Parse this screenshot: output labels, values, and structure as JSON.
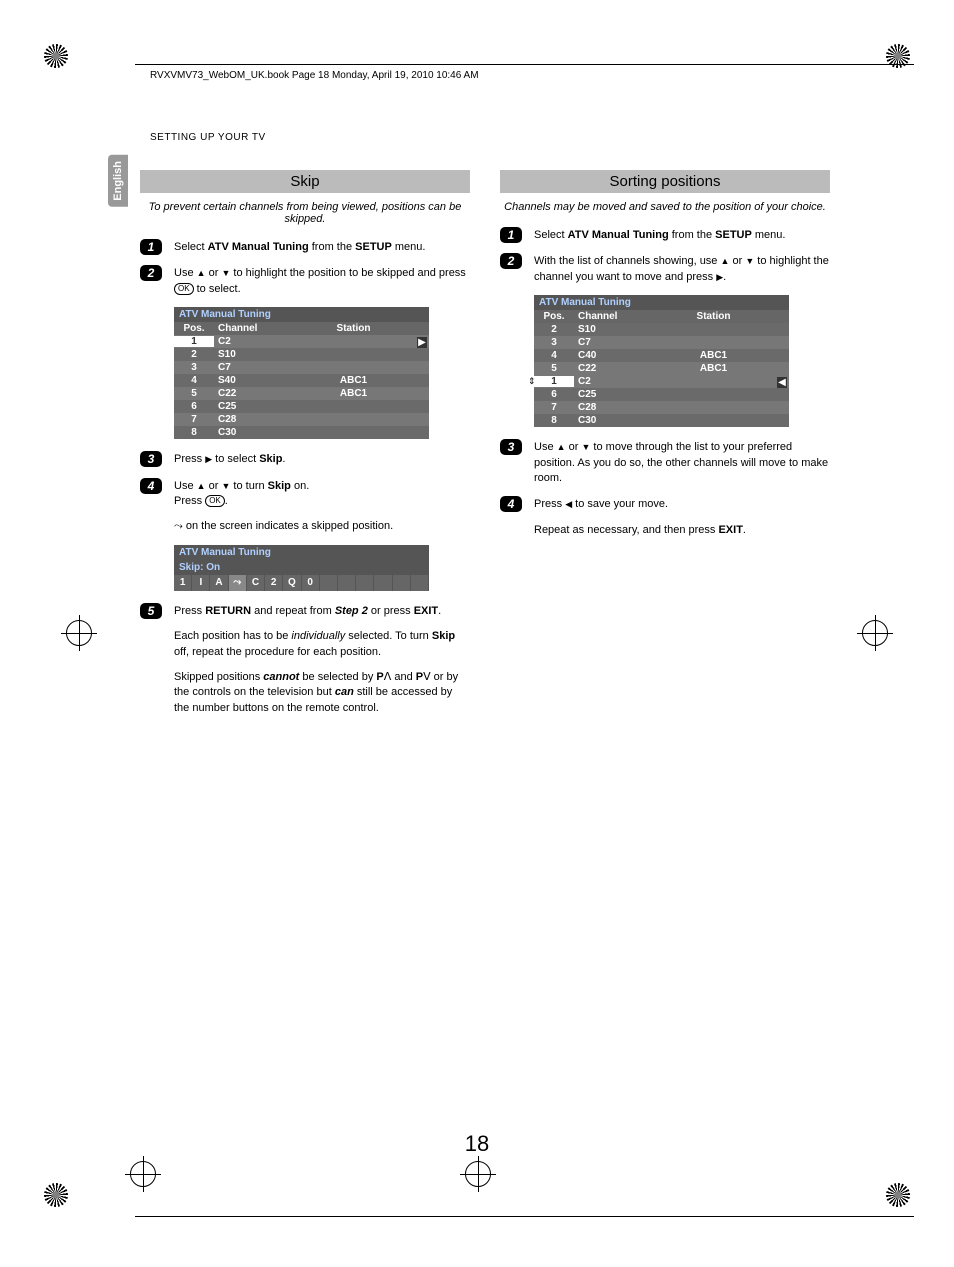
{
  "header": {
    "file_info": "RVXVMV73_WebOM_UK.book  Page 18  Monday, April 19, 2010  10:46 AM",
    "section": "SETTING UP YOUR TV",
    "lang_tab": "English"
  },
  "left": {
    "heading": "Skip",
    "intro": "To prevent certain channels from being viewed, positions can be skipped.",
    "step1_pre": "Select ",
    "step1_b1": "ATV Manual Tuning",
    "step1_mid": " from the ",
    "step1_b2": "SETUP",
    "step1_post": " menu.",
    "step2_pre": "Use ",
    "step2_mid": " or ",
    "step2_post": " to highlight the position to be skipped and press ",
    "step2_end": " to select.",
    "osd_title": "ATV Manual Tuning",
    "osd_h1": "Pos.",
    "osd_h2": "Channel",
    "osd_h3": "Station",
    "rows": [
      {
        "pos": "1",
        "ch": "C2",
        "st": ""
      },
      {
        "pos": "2",
        "ch": "S10",
        "st": ""
      },
      {
        "pos": "3",
        "ch": "C7",
        "st": ""
      },
      {
        "pos": "4",
        "ch": "S40",
        "st": "ABC1"
      },
      {
        "pos": "5",
        "ch": "C22",
        "st": "ABC1"
      },
      {
        "pos": "6",
        "ch": "C25",
        "st": ""
      },
      {
        "pos": "7",
        "ch": "C28",
        "st": ""
      },
      {
        "pos": "8",
        "ch": "C30",
        "st": ""
      }
    ],
    "step3_pre": "Press ",
    "step3_post": " to select ",
    "step3_b": "Skip",
    "step3_end": ".",
    "step4_pre": "Use ",
    "step4_mid": " or ",
    "step4_post": " to turn ",
    "step4_b": "Skip",
    "step4_on": " on.",
    "step4_press": "Press ",
    "step4_end": ".",
    "skip_note_post": " on the screen indicates a skipped position.",
    "skip_osd_title": "ATV Manual Tuning",
    "skip_label": "Skip: On",
    "skip_cells": [
      "1",
      "I",
      "A",
      "",
      "C",
      "2",
      "Q",
      "0",
      "",
      "",
      "",
      "",
      "",
      ""
    ],
    "step5_pre": "Press ",
    "step5_b1": "RETURN",
    "step5_mid": " and repeat from ",
    "step5_it": "Step 2",
    "step5_mid2": " or press ",
    "step5_b2": "EXIT",
    "step5_end": ".",
    "para1_pre": "Each position has to be ",
    "para1_it": "individually",
    "para1_mid": " selected. To turn ",
    "para1_b": "Skip",
    "para1_post": " off, repeat the procedure for each position.",
    "para2_pre": "Skipped positions ",
    "para2_b1": "cannot",
    "para2_mid": " be selected by ",
    "para2_p1": "P",
    "para2_and": " and ",
    "para2_p2": "P",
    "para2_mid2": " or by the controls on the television but ",
    "para2_b2": "can",
    "para2_post": " still be accessed by the number buttons on the remote control."
  },
  "right": {
    "heading": "Sorting positions",
    "intro": "Channels may be moved and saved to the position of your choice.",
    "step1_pre": "Select ",
    "step1_b1": "ATV Manual Tuning",
    "step1_mid": " from the ",
    "step1_b2": "SETUP",
    "step1_post": " menu.",
    "step2_pre": "With the list of channels showing, use ",
    "step2_mid": " or ",
    "step2_post": " to highlight the channel you want to move and press ",
    "step2_end": ".",
    "osd_title": "ATV Manual Tuning",
    "osd_h1": "Pos.",
    "osd_h2": "Channel",
    "osd_h3": "Station",
    "rows": [
      {
        "pos": "2",
        "ch": "S10",
        "st": ""
      },
      {
        "pos": "3",
        "ch": "C7",
        "st": ""
      },
      {
        "pos": "4",
        "ch": "C40",
        "st": "ABC1"
      },
      {
        "pos": "5",
        "ch": "C22",
        "st": "ABC1"
      },
      {
        "pos": "1",
        "ch": "C2",
        "st": ""
      },
      {
        "pos": "6",
        "ch": "C25",
        "st": ""
      },
      {
        "pos": "7",
        "ch": "C28",
        "st": ""
      },
      {
        "pos": "8",
        "ch": "C30",
        "st": ""
      }
    ],
    "step3_pre": "Use ",
    "step3_mid": " or ",
    "step3_post": " to move through the list to your preferred position. As you do so, the other channels will move to make room.",
    "step4_pre": "Press ",
    "step4_post": " to save your move.",
    "para_pre": "Repeat as necessary, and then press ",
    "para_b": "EXIT",
    "para_end": "."
  },
  "page_number": "18",
  "icons": {
    "up": "▲",
    "down": "▼",
    "right": "▶",
    "left": "◀",
    "ok": "OK",
    "p_up": "ᐱ",
    "p_down": "ᐯ",
    "skip_icon": "⤳"
  }
}
